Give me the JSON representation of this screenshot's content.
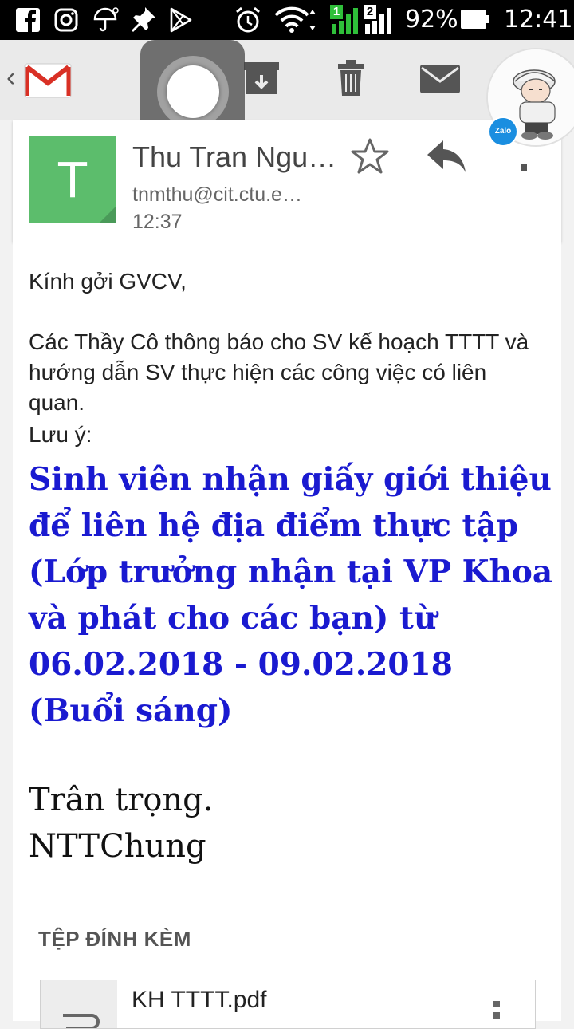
{
  "status_bar": {
    "battery": "92%",
    "time": "12:41",
    "sim1": "1",
    "sim2": "2"
  },
  "toolbar": {
    "app": "Gmail"
  },
  "message": {
    "avatar_letter": "T",
    "sender": "Thu Tran Ngu…",
    "email": "tnmthu@cit.ctu.e…",
    "time": "12:37"
  },
  "body": {
    "greeting": "Kính gởi GVCV,",
    "paragraph": "Các Thầy Cô thông báo cho SV kế hoạch TTTT và hướng dẫn SV thực hiện các công việc có liên quan.",
    "note_label": "Lưu ý:",
    "highlight": "Sinh viên nhận giấy giới thiệu để liên hệ địa điểm thực tập (Lớp trưởng nhận tại VP Khoa và phát cho các bạn) từ 06.02.2018 - 09.02.2018 (Buổi sáng)",
    "sign_line1": "Trân trọng.",
    "sign_line2": "NTTChung"
  },
  "attachments": {
    "title": "TỆP ĐÍNH KÈM",
    "items": [
      {
        "name": "KH TTTT.pdf"
      }
    ]
  },
  "overlay": {
    "badge": "Zalo"
  },
  "colors": {
    "avatar": "#5cbd6c",
    "highlight_text": "#1a1ad0",
    "gmail_red": "#d93025"
  }
}
